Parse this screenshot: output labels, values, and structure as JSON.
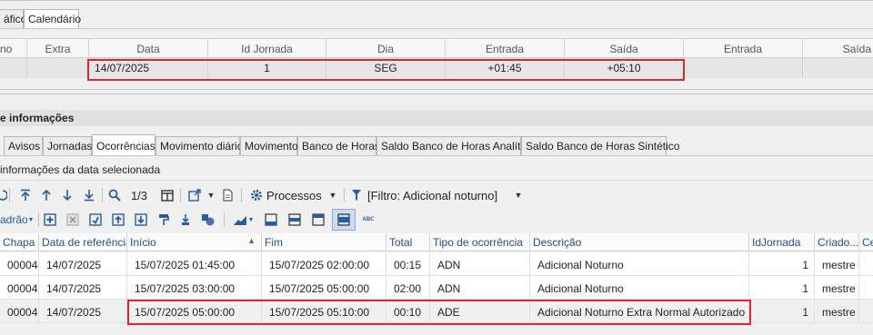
{
  "top_tabs": [
    "áfico",
    "Calendário"
  ],
  "grid1": {
    "headers": [
      "no",
      "Extra",
      "Data",
      "Id Jornada",
      "Dia",
      "Entrada",
      "Saída",
      "Entrada",
      "Saída"
    ],
    "row": [
      "",
      "",
      "14/07/2025",
      "1",
      "SEG",
      "+01:45",
      "+05:10",
      "",
      ""
    ]
  },
  "section_title": "e informações",
  "detail_tabs": [
    "Avisos",
    "Jornadas",
    "Ocorrências",
    "Movimento diário",
    "Movimento",
    "Banco de Horas",
    "Saldo Banco de Horas Analítico",
    "Saldo Banco de Horas Sintético"
  ],
  "subtitle": "informações da data selecionada",
  "toolbar1": {
    "page_counter": "1/3",
    "processos_label": "Processos",
    "filter_label": "[Filtro: Adicional noturno]"
  },
  "toolbar2": {
    "padrao_label": "adrão",
    "abc_label": "ABC"
  },
  "grid2": {
    "headers": [
      "Chapa",
      "Data de referência",
      "Início",
      "Fim",
      "Total",
      "Tipo de ocorrência",
      "Descrição",
      "IdJornada",
      "Criado...",
      "Ce"
    ],
    "rows": [
      [
        "00004",
        "14/07/2025",
        "15/07/2025 01:45:00",
        "15/07/2025 02:00:00",
        "00:15",
        "ADN",
        "Adicional Noturno",
        "1",
        "mestre",
        ""
      ],
      [
        "00004",
        "14/07/2025",
        "15/07/2025 03:00:00",
        "15/07/2025 05:00:00",
        "02:00",
        "ADN",
        "Adicional Noturno",
        "1",
        "mestre",
        ""
      ],
      [
        "00004",
        "14/07/2025",
        "15/07/2025 05:00:00",
        "15/07/2025 05:10:00",
        "00:10",
        "ADE",
        "Adicional Noturno Extra Normal Autorizado",
        "1",
        "mestre",
        ""
      ]
    ]
  },
  "colors": {
    "highlight": "#d9292b",
    "link_blue": "#2a5d9f"
  }
}
